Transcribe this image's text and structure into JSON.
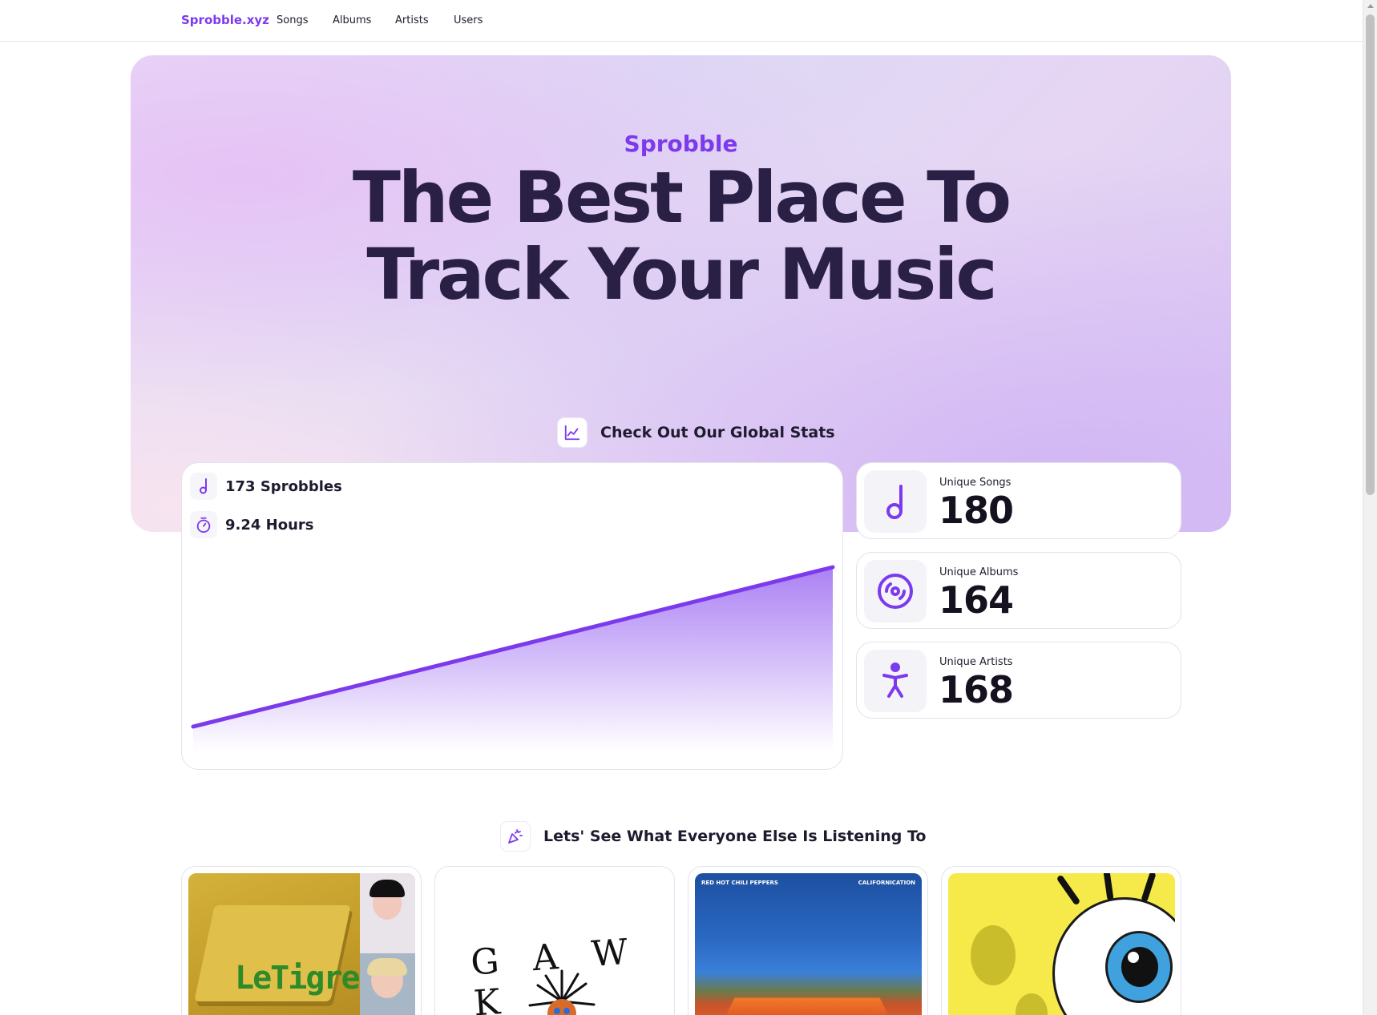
{
  "nav": {
    "brand": "Sprobble.xyz",
    "links": [
      "Songs",
      "Albums",
      "Artists",
      "Users"
    ]
  },
  "hero": {
    "eyebrow": "Sprobble",
    "headline_line1": "The Best Place To",
    "headline_line2": "Track Your Music"
  },
  "global_stats": {
    "heading": "Check Out Our Global Stats",
    "heading_icon": "line-chart-icon",
    "sprobbles": "173 Sprobbles",
    "hours": "9.24 Hours",
    "sprobbles_icon": "music-note-icon",
    "hours_icon": "timer-icon"
  },
  "chart_data": {
    "type": "area",
    "values": [
      0,
      173
    ],
    "color": "#7c3aed"
  },
  "stat_cards": [
    {
      "label": "Unique Songs",
      "value": "180",
      "icon": "music-note-icon"
    },
    {
      "label": "Unique Albums",
      "value": "164",
      "icon": "disc-icon"
    },
    {
      "label": "Unique Artists",
      "value": "168",
      "icon": "person-icon"
    }
  ],
  "listening": {
    "heading": "Lets' See What Everyone Else Is Listening To",
    "heading_icon": "party-popper-icon",
    "albums": [
      {
        "art_text": "LeTigre"
      },
      {
        "art_text": "G A W K"
      },
      {
        "art_text_left": "RED HOT CHILI PEPPERS",
        "art_text_right": "CALIFORNICATION"
      },
      {
        "art_text": ""
      }
    ]
  },
  "colors": {
    "accent": "#7c3aed",
    "text_dark": "#2a1f45"
  }
}
